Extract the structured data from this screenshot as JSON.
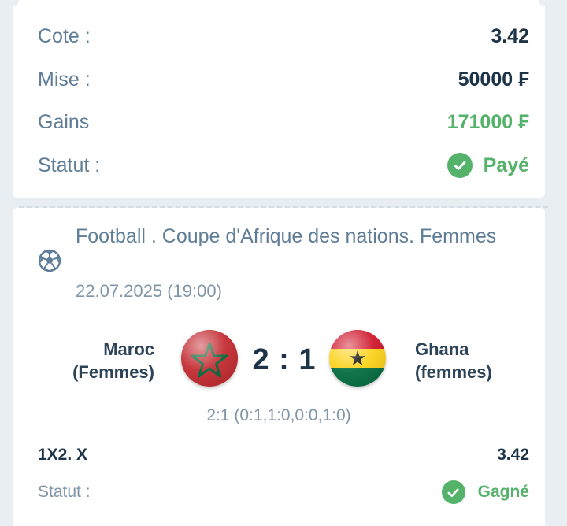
{
  "summary": {
    "odds_label": "Cote :",
    "odds_value": "3.42",
    "stake_label": "Mise :",
    "stake_value": "50000 ₣",
    "winnings_label": "Gains",
    "winnings_value": "171000 ₣",
    "status_label": "Statut :",
    "status_value": "Payé"
  },
  "event": {
    "sport_icon": "soccer-ball-icon",
    "league": "Football . Coupe d'Afrique des nations. Femmes",
    "datetime": "22.07.2025 (19:00)",
    "home_team_line1": "Maroc",
    "home_team_line2": "(Femmes)",
    "away_team_line1": "Ghana",
    "away_team_line2": "(femmes)",
    "score": "2 : 1",
    "score_detail": "2:1 (0:1,1:0,0:0,1:0)"
  },
  "bet": {
    "market": "1X2. X",
    "odds": "3.42",
    "status_label": "Statut :",
    "status_value": "Gagné"
  },
  "colors": {
    "green": "#55b26a",
    "label": "#5f7d97",
    "dark": "#1d3347",
    "morocco_red": "#c1272d",
    "morocco_star": "#006233",
    "ghana_red": "#ce1126",
    "ghana_yellow": "#fcd116",
    "ghana_green": "#006b3f"
  }
}
